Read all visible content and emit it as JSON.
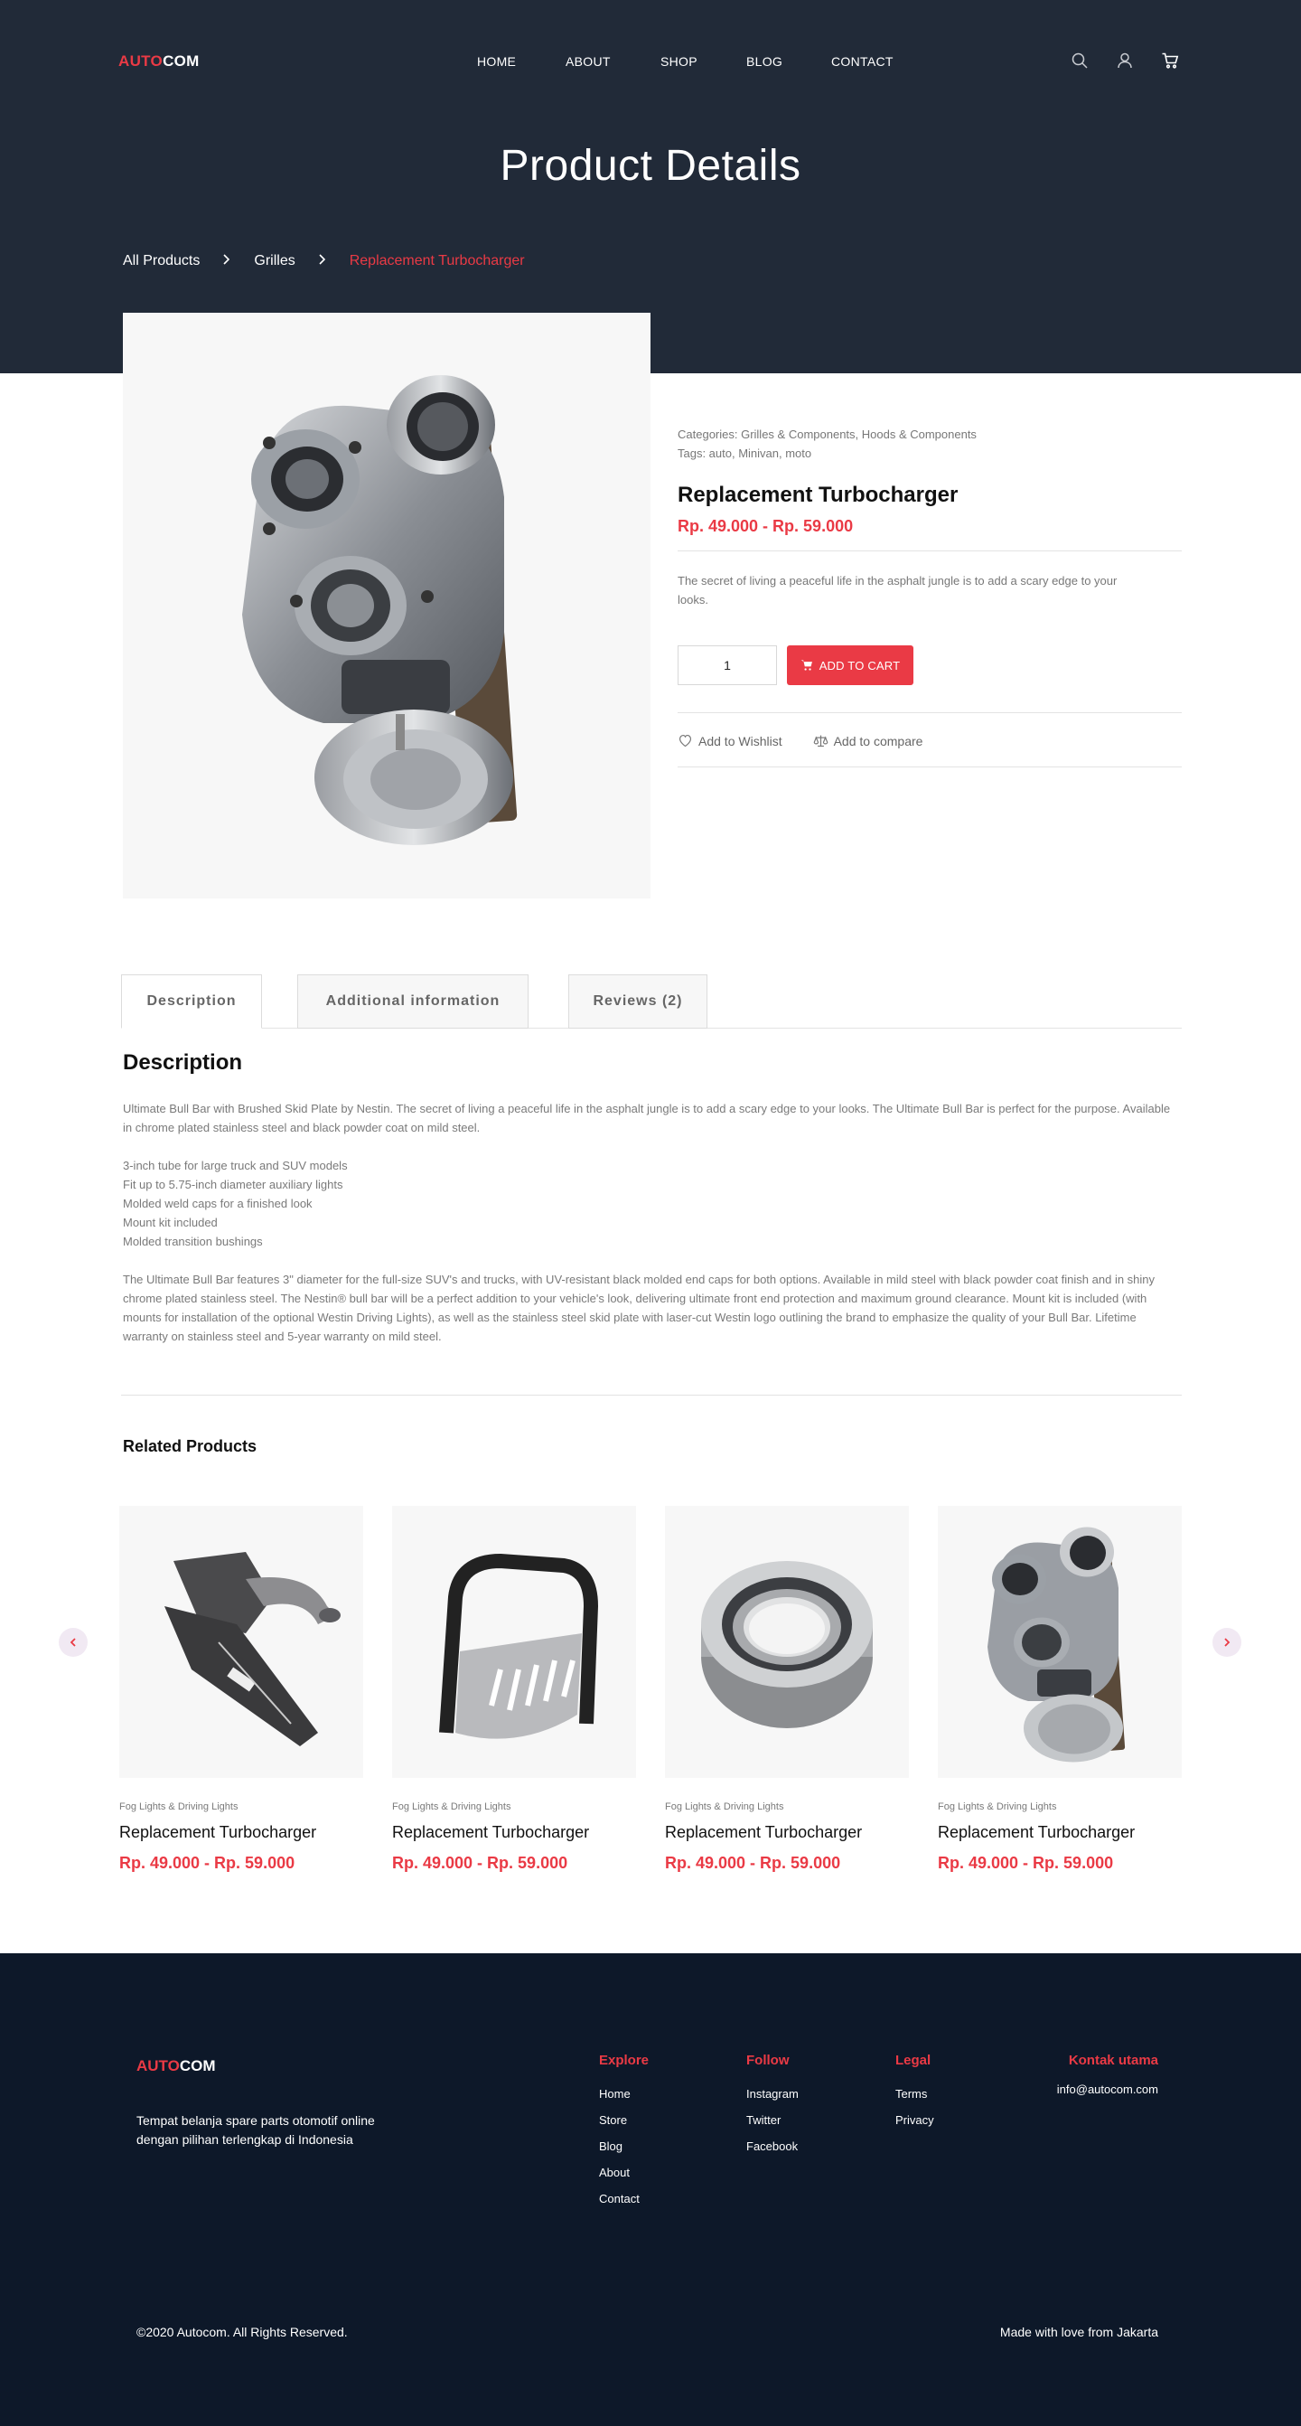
{
  "brand": {
    "part1": "AUTO",
    "part2": "COM",
    "accent": "#ea3a45",
    "dark": "#212a38",
    "footer_bg": "#0d1829"
  },
  "nav": {
    "items": [
      "HOME",
      "ABOUT",
      "SHOP",
      "BLOG",
      "CONTACT"
    ],
    "icons": [
      "search-icon",
      "user-icon",
      "cart-icon"
    ]
  },
  "hero": {
    "title": "Product Details"
  },
  "breadcrumb": {
    "items": [
      "All Products",
      "Grilles"
    ],
    "current": "Replacement Turbocharger",
    "separator": "›"
  },
  "product": {
    "categories": "Categories: Grilles & Components, Hoods & Components",
    "tags": "Tags: auto, Minivan, moto",
    "title": "Replacement Turbocharger",
    "price": "Rp. 49.000 - Rp. 59.000",
    "short_description": "The secret of living a peaceful life in the asphalt jungle is to add a scary edge to your looks.",
    "quantity": "1",
    "add_to_cart": "ADD TO CART",
    "wishlist": "Add to Wishlist",
    "compare": "Add to compare"
  },
  "tabs": {
    "items": [
      "Description",
      "Additional information",
      "Reviews (2)"
    ],
    "active": 0
  },
  "description": {
    "title": "Description",
    "intro": "Ultimate Bull Bar with Brushed Skid Plate by Nestin. The secret of living a peaceful life in the asphalt jungle is to add a scary edge to your looks. The Ultimate Bull Bar is perfect for the purpose. Available in chrome plated stainless steel and black powder coat on mild steel.",
    "features": [
      "3-inch tube for large truck and SUV models",
      "Fit up to 5.75-inch diameter auxiliary lights",
      "Molded weld caps for a finished look",
      "Mount kit included",
      "Molded transition bushings"
    ],
    "outro": "The Ultimate Bull Bar features 3\" diameter for the full-size SUV's and trucks, with UV-resistant black molded end caps for both options. Available in mild steel with black powder coat finish and in shiny chrome plated stainless steel. The Nestin® bull bar will be a perfect addition to your vehicle's look, delivering ultimate front end protection and maximum ground clearance. Mount kit is included (with mounts for installation of the optional Westin Driving Lights), as well as the stainless steel skid plate with laser-cut Westin logo outlining the brand to emphasize the quality of your Bull Bar. Lifetime warranty on stainless steel and 5-year warranty on mild steel."
  },
  "related": {
    "title": "Related Products",
    "items": [
      {
        "category": "Fog Lights & Driving Lights",
        "title": "Replacement Turbocharger",
        "price": "Rp. 49.000 - Rp. 59.000",
        "image": "air-intake"
      },
      {
        "category": "Fog Lights & Driving Lights",
        "title": "Replacement Turbocharger",
        "price": "Rp. 49.000 - Rp. 59.000",
        "image": "bull-bar"
      },
      {
        "category": "Fog Lights & Driving Lights",
        "title": "Replacement Turbocharger",
        "price": "Rp. 49.000 - Rp. 59.000",
        "image": "wheel-bearing"
      },
      {
        "category": "Fog Lights & Driving Lights",
        "title": "Replacement Turbocharger",
        "price": "Rp. 49.000 - Rp. 59.000",
        "image": "turbocharger"
      }
    ]
  },
  "footer": {
    "tagline": "Tempat belanja spare parts otomotif online dengan pilihan terlengkap di Indonesia",
    "explore": {
      "title": "Explore",
      "links": [
        "Home",
        "Store",
        "Blog",
        "About",
        "Contact"
      ]
    },
    "follow": {
      "title": "Follow",
      "links": [
        "Instagram",
        "Twitter",
        "Facebook"
      ]
    },
    "legal": {
      "title": "Legal",
      "links": [
        "Terms",
        "Privacy"
      ]
    },
    "contact": {
      "title": "Kontak utama",
      "email": "info@autocom.com"
    },
    "copyright": "©2020 Autocom. All Rights Reserved.",
    "made": "Made with love from Jakarta"
  }
}
